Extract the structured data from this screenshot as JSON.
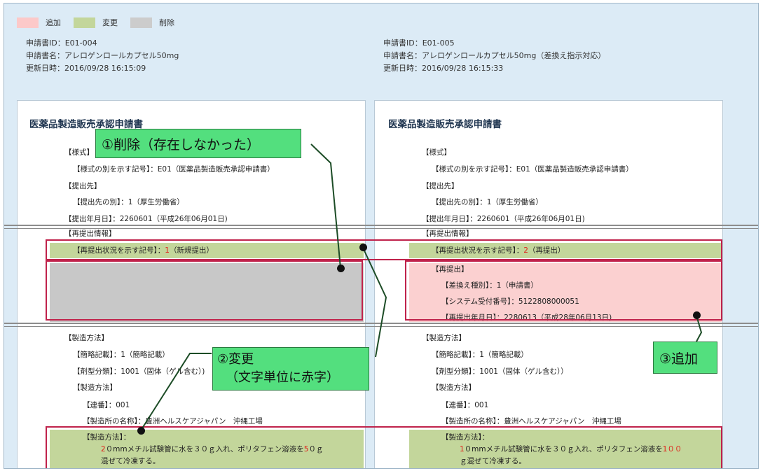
{
  "legend": [
    {
      "label": "追加",
      "color": "#fcc9c9"
    },
    {
      "label": "変更",
      "color": "#c3d69b"
    },
    {
      "label": "削除",
      "color": "#cccccc"
    }
  ],
  "left_meta": {
    "id": "申請書ID：E01-004",
    "name": "申請書名：アレロゲンロールカプセル50mg",
    "updated": "更新日時：2016/09/28 16:15:09"
  },
  "right_meta": {
    "id": "申請書ID：E01-005",
    "name": "申請書名：アレロゲンロールカプセル50mg（差換え指示対応）",
    "updated": "更新日時：2016/09/28 16:15:33"
  },
  "left_doc": {
    "title": "医薬品製造販売承認申請書",
    "yoshiki": "【様式】",
    "yoshiki_code": "【様式の別を示す記号】：E01（医薬品製造販売承認申請書）",
    "teishutsusaki": "【提出先】",
    "teishutsusaki_betsu": "【提出先の別】：1（厚生労働省）",
    "teishutsu_date": "【提出年月日】：2260601（平成26年06月01日)",
    "saiteishutsu_info": "【再提出情報】",
    "saiteishutsu_status_label": "【再提出状況を示す記号】：",
    "saiteishutsu_status_code": "1",
    "saiteishutsu_status_text": "（新規提出）",
    "seizo_hoho": "【製造方法】",
    "kanryaku": "【簡略記載】：1（簡略記載）",
    "zaikei": "【剤型分類】：1001（固体（ゲル含む）)",
    "seizo_hoho2": "【製造方法】",
    "renban": "【連番】：001",
    "seizosho": "【製造所の名称】：豊洲ヘルスケアジャパン　沖縄工場",
    "seizo_hoho3": "【製造方法】：",
    "method_a": "2",
    "method_b": "０mmメチル試験管に水を３０ｇ入れ、ポリタフェン溶液を",
    "method_c": "5",
    "method_d": "０ｇ",
    "method_line2": "混ぜて冷凍する。"
  },
  "right_doc": {
    "title": "医薬品製造販売承認申請書",
    "yoshiki": "【様式】",
    "yoshiki_code": "【様式の別を示す記号】：E01（医薬品製造販売承認申請書）",
    "teishutsusaki": "【提出先】",
    "teishutsusaki_betsu": "【提出先の別】：1（厚生労働省）",
    "teishutsu_date": "【提出年月日】：2260601（平成26年06月01日)",
    "saiteishutsu_info": "【再提出情報】",
    "saiteishutsu_status_label": "【再提出状況を示す記号】：",
    "saiteishutsu_status_code": "2",
    "saiteishutsu_status_text": "（再提出）",
    "saiteishutsu": "【再提出】",
    "sashikae": "【差換え種別】：1（申請書）",
    "system_no": "【システム受付番号】：5122808000051",
    "saiteishutsu_date": "【再提出年月日】：2280613（平成28年06月13日)",
    "seizo_hoho": "【製造方法】",
    "kanryaku": "【簡略記載】：1（簡略記載）",
    "zaikei": "【剤型分類】：1001（固体（ゲル含む））",
    "seizo_hoho2": "【製造方法】",
    "renban": "【連番】：001",
    "seizosho": "【製造所の名称】：豊洲ヘルスケアジャパン　沖縄工場",
    "seizo_hoho3": "【製造方法】：",
    "method_a": "1",
    "method_b": "０mmメチル試験管に水を３０ｇ入れ、ポリタフェン溶液を",
    "method_c": "1００",
    "method_line2": "ｇ混ぜて冷凍する。"
  },
  "callouts": {
    "delete": "①削除（存在しなかった）",
    "change_line1": "②変更",
    "change_line2": "（文字単位に赤字）",
    "add": "③追加"
  }
}
